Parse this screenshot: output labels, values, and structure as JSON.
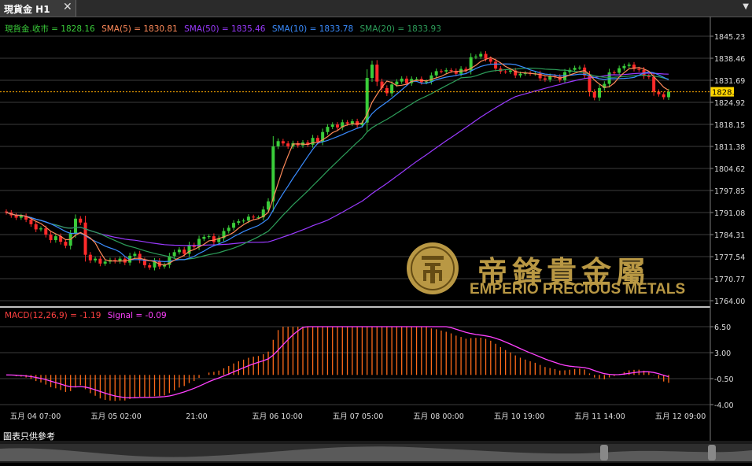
{
  "tab": {
    "title": "現貨金 H1",
    "close_glyph": "✕",
    "menu_glyph": "▼"
  },
  "footer_text": "圖表只供參考",
  "watermark": {
    "chinese": "帝鋒貴金屬",
    "english": "EMPERIO PRECIOUS METALS"
  },
  "colors": {
    "bullish": "#3acd3a",
    "bearish": "#ff2a2a",
    "sma5": "#ff8a5a",
    "sma10": "#3a8cff",
    "sma20": "#2d9e5a",
    "sma50": "#9a3aff",
    "macd_bar": "#ff6a1a",
    "signal": "#ff40ff",
    "price_line": "#ffaa00",
    "gold": "#c9a54a"
  },
  "chart_data": [
    {
      "type": "candlestick",
      "symbol": "現貨金",
      "timeframe": "H1",
      "legend": [
        {
          "label": "現貨金.收市 = 1828.16",
          "color": "#3acd3a"
        },
        {
          "label": "SMA(5) = 1830.81",
          "color": "#ff8a5a"
        },
        {
          "label": "SMA(50) = 1835.46",
          "color": "#9a3aff"
        },
        {
          "label": "SMA(10) = 1833.78",
          "color": "#3a8cff"
        },
        {
          "label": "SMA(20) = 1833.93",
          "color": "#2d9e5a"
        }
      ],
      "y_ticks": [
        "1845.23",
        "1838.46",
        "1831.69",
        "1824.92",
        "1818.15",
        "1811.38",
        "1804.62",
        "1797.85",
        "1791.08",
        "1784.31",
        "1777.54",
        "1770.77",
        "1764.00"
      ],
      "y_range": [
        1764.0,
        1845.23
      ],
      "current_price": "1828.16",
      "x_labels": [
        "五月 04 07:00",
        "五月 05 02:00",
        "21:00",
        "五月 06 10:00",
        "五月 07 05:00",
        "五月 08 00:00",
        "五月 10 19:00",
        "五月 11 14:00",
        "五月 12 09:00"
      ],
      "close_series": [
        1791.1,
        1790.2,
        1789.5,
        1790.0,
        1788.9,
        1787.5,
        1785.9,
        1786.2,
        1784.3,
        1782.6,
        1783.8,
        1782.1,
        1780.9,
        1784.6,
        1789.2,
        1788.0,
        1778.1,
        1776.4,
        1776.9,
        1775.4,
        1776.0,
        1776.5,
        1776.1,
        1776.9,
        1775.7,
        1777.8,
        1778.4,
        1776.4,
        1774.9,
        1774.2,
        1776.2,
        1774.5,
        1775.0,
        1777.7,
        1778.9,
        1779.7,
        1778.4,
        1781.1,
        1780.5,
        1783.0,
        1783.6,
        1783.8,
        1782.0,
        1783.2,
        1785.4,
        1786.4,
        1787.9,
        1788.4,
        1788.6,
        1789.8,
        1789.6,
        1789.6,
        1792.0,
        1794.5,
        1811.4,
        1813.0,
        1812.3,
        1811.4,
        1812.4,
        1811.7,
        1812.6,
        1811.9,
        1814.0,
        1812.8,
        1815.8,
        1817.4,
        1818.1,
        1817.2,
        1818.8,
        1818.4,
        1819.1,
        1817.9,
        1818.7,
        1832.4,
        1836.5,
        1831.3,
        1829.3,
        1827.7,
        1830.4,
        1831.3,
        1832.2,
        1830.8,
        1832.1,
        1832.1,
        1831.1,
        1831.3,
        1833.2,
        1834.5,
        1834.4,
        1834.8,
        1834.6,
        1833.7,
        1835.2,
        1834.7,
        1838.8,
        1839.0,
        1839.8,
        1838.3,
        1837.4,
        1835.3,
        1834.4,
        1834.3,
        1834.7,
        1833.2,
        1833.7,
        1833.9,
        1833.7,
        1833.8,
        1832.3,
        1831.9,
        1833.0,
        1832.8,
        1831.8,
        1834.2,
        1834.9,
        1835.5,
        1835.6,
        1833.2,
        1828.1,
        1826.4,
        1829.3,
        1830.6,
        1834.1,
        1834.0,
        1835.4,
        1836.1,
        1836.5,
        1835.2,
        1834.9,
        1833.0,
        1832.7,
        1828.2,
        1827.4,
        1826.5,
        1828.2
      ]
    },
    {
      "type": "macd",
      "title": "MACD(12,26,9) = -1.19 Signal = -0.09",
      "title_parts": [
        {
          "text": "MACD(12,26,9) = -1.19",
          "color": "#ff4040"
        },
        {
          "text": "Signal = -0.09",
          "color": "#ff40ff"
        }
      ],
      "y_ticks": [
        "6.50",
        "3.00",
        "-0.50",
        "-4.00"
      ],
      "y_range": [
        -4.0,
        6.5
      ]
    }
  ]
}
